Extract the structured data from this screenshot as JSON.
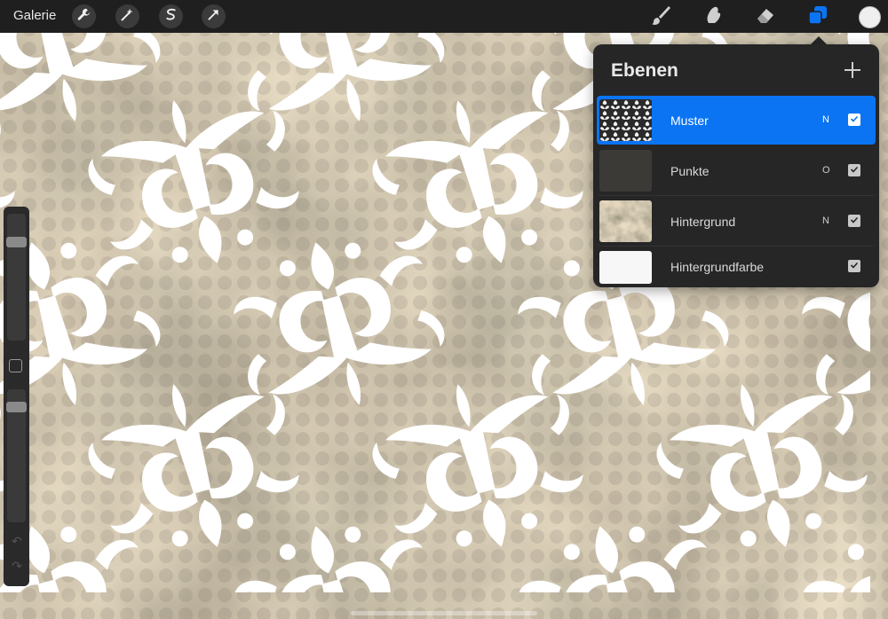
{
  "toolbar": {
    "gallery_label": "Galerie",
    "left_tools": [
      "wrench-icon",
      "magic-wand-icon",
      "selection-icon",
      "transform-arrow-icon"
    ],
    "right_tools": [
      "brush-icon",
      "smudge-icon",
      "eraser-icon",
      "layers-icon"
    ],
    "active_tool": "layers-icon",
    "accent_color": "#0a74f3",
    "current_color": "#efefef"
  },
  "sidebar": {
    "brush_size_level": 0.2,
    "opacity_level": 0.1
  },
  "layers_panel": {
    "title": "Ebenen",
    "add_icon": "plus-icon",
    "layers": [
      {
        "name": "Muster",
        "blend": "N",
        "visible": true,
        "active": true
      },
      {
        "name": "Punkte",
        "blend": "O",
        "visible": true,
        "active": false
      },
      {
        "name": "Hintergrund",
        "blend": "N",
        "visible": true,
        "active": false
      },
      {
        "name": "Hintergrundfarbe",
        "blend": "",
        "visible": true,
        "active": false
      }
    ]
  }
}
